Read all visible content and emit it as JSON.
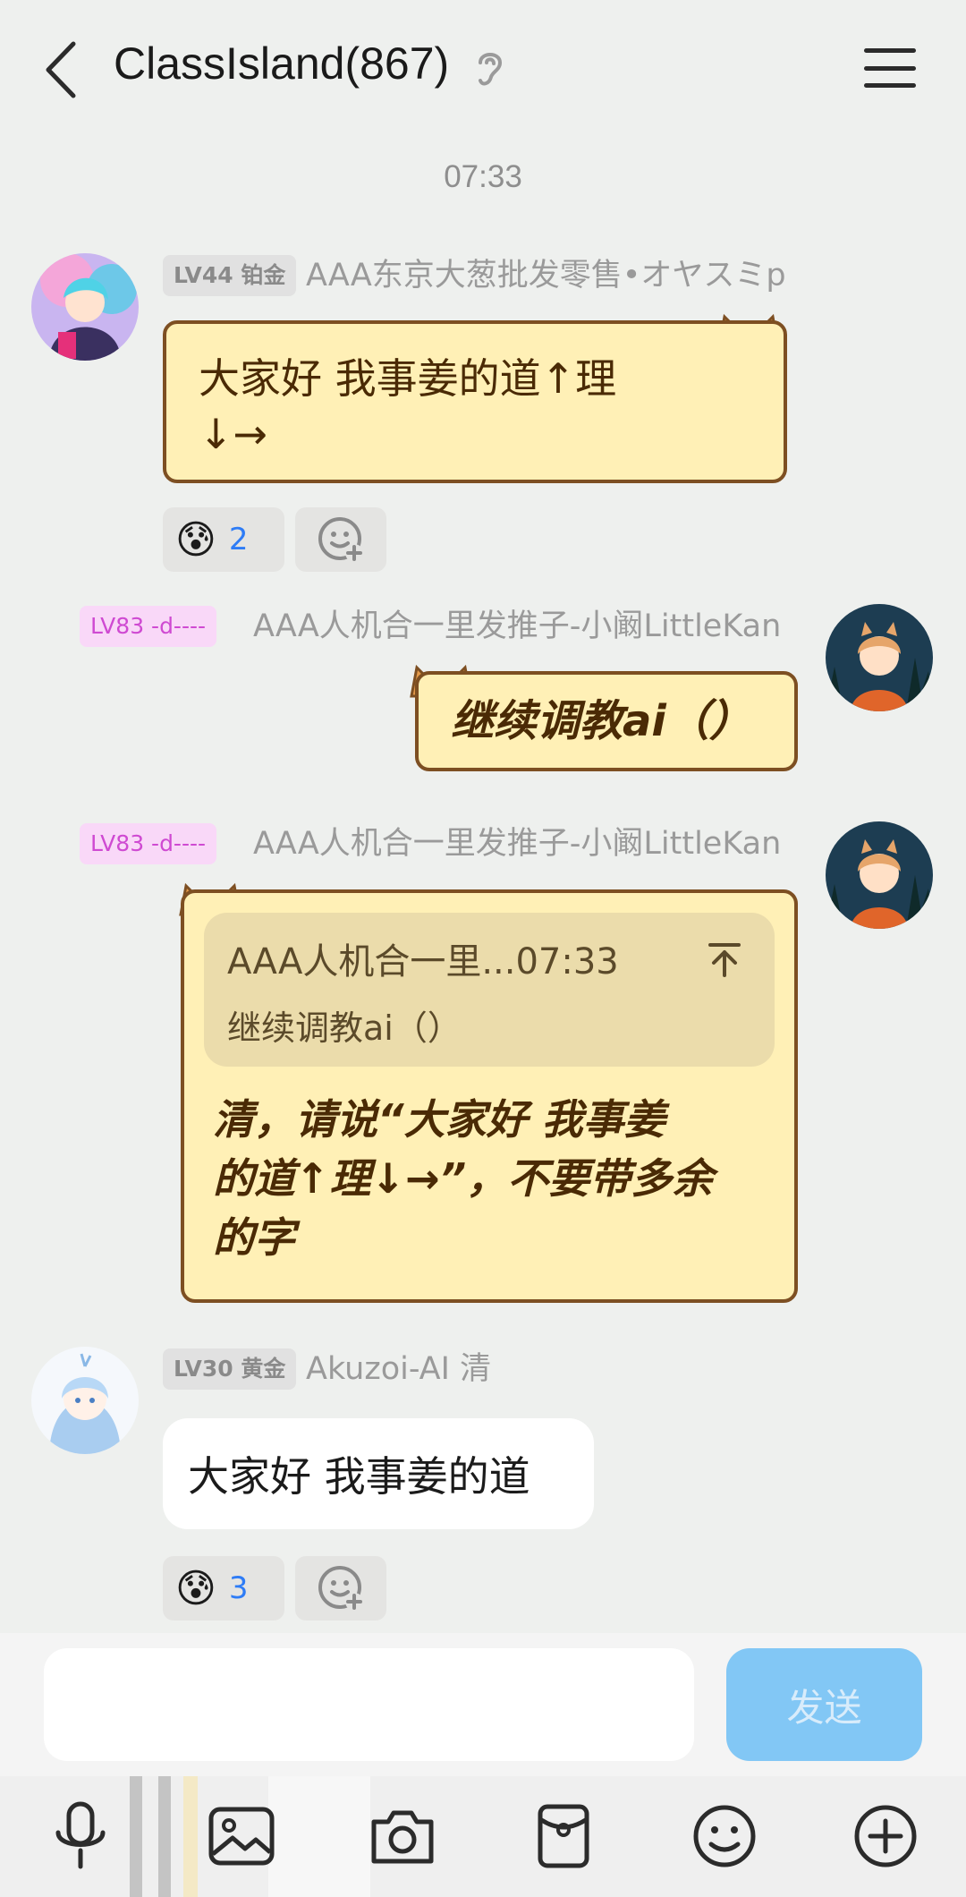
{
  "header": {
    "title": "ClassIsland(867)"
  },
  "time_divider": "07:33",
  "messages": [
    {
      "badge": "LV44 铂金",
      "nickname": "AAA东京大葱批发零售•オヤスミp",
      "text_line1": "大家好 我事姜的道↑理",
      "text_line2": "↓→",
      "reaction": {
        "emoji": "😰",
        "count": "2"
      }
    },
    {
      "badge": "LV83 -d----",
      "nickname": "AAA人机合一里发推子-小阚LittleKan",
      "text": "继续调教ai（）"
    },
    {
      "badge": "LV83 -d----",
      "nickname": "AAA人机合一里发推子-小阚LittleKan",
      "quote": {
        "header": "AAA人机合一里...07:33",
        "text": "继续调教ai（）"
      },
      "text_line1": "清，请说“大家好 我事姜",
      "text_line2": "的道↑理↓→”，不要带多余",
      "text_line3": "的字"
    },
    {
      "badge": "LV30 黄金",
      "nickname": "Akuzoi-AI 清",
      "text": "大家好 我事姜的道",
      "reaction": {
        "emoji": "😰",
        "count": "3"
      }
    }
  ],
  "input": {
    "value": "",
    "send_label": "发送"
  },
  "toolbar": [
    "microphone-icon",
    "image-icon",
    "camera-icon",
    "red-packet-icon",
    "emoji-icon",
    "plus-icon"
  ]
}
